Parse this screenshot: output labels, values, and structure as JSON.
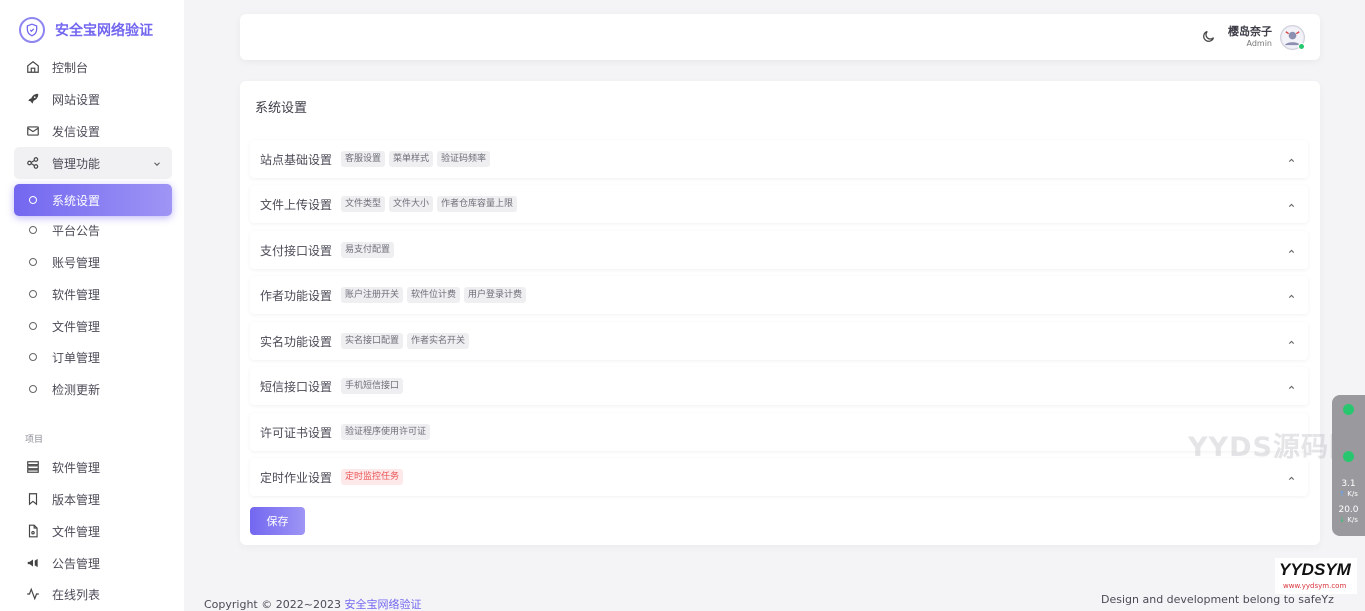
{
  "brand": {
    "title": "安全宝网络验证"
  },
  "sidebar": {
    "items": [
      {
        "label": "控制台",
        "icon": "home-icon"
      },
      {
        "label": "网站设置",
        "icon": "rocket-icon"
      },
      {
        "label": "发信设置",
        "icon": "mail-icon"
      }
    ],
    "group": {
      "label": "管理功能",
      "icon": "share-nodes-icon"
    },
    "sub_items": [
      {
        "label": "系统设置",
        "active": true
      },
      {
        "label": "平台公告"
      },
      {
        "label": "账号管理"
      },
      {
        "label": "软件管理"
      },
      {
        "label": "文件管理"
      },
      {
        "label": "订单管理"
      },
      {
        "label": "检测更新"
      }
    ],
    "section_label": "项目",
    "project_items": [
      {
        "label": "软件管理",
        "icon": "server-icon"
      },
      {
        "label": "版本管理",
        "icon": "bookmark-icon"
      },
      {
        "label": "文件管理",
        "icon": "file-icon"
      },
      {
        "label": "公告管理",
        "icon": "megaphone-icon"
      },
      {
        "label": "在线列表",
        "icon": "activity-icon"
      }
    ]
  },
  "header": {
    "user_name": "樱岛奈子",
    "user_role": "Admin"
  },
  "main": {
    "title": "系统设置",
    "sections": [
      {
        "title": "站点基础设置",
        "tags": [
          "客服设置",
          "菜单样式",
          "验证码频率"
        ]
      },
      {
        "title": "文件上传设置",
        "tags": [
          "文件类型",
          "文件大小",
          "作者仓库容量上限"
        ]
      },
      {
        "title": "支付接口设置",
        "tags": [
          "易支付配置"
        ]
      },
      {
        "title": "作者功能设置",
        "tags": [
          "账户注册开关",
          "软件位计费",
          "用户登录计费"
        ]
      },
      {
        "title": "实名功能设置",
        "tags": [
          "实名接口配置",
          "作者实名开关"
        ]
      },
      {
        "title": "短信接口设置",
        "tags": [
          "手机短信接口"
        ]
      },
      {
        "title": "许可证书设置",
        "tags": [
          "验证程序使用许可证"
        ]
      },
      {
        "title": "定时作业设置",
        "tags": [
          "定时监控任务"
        ]
      }
    ],
    "save_label": "保存"
  },
  "footer": {
    "copyright": "Copyright © 2022~2023",
    "link": "安全宝网络验证",
    "right": "Design and development belong to safeYz"
  },
  "widget": {
    "upload": "3.1",
    "upload_unit": "K/s",
    "download": "20.0",
    "download_unit": "K/s"
  },
  "watermark": {
    "text": "YYDS源码网",
    "badge": "YYDSYM",
    "badge_url": "www.yydsym.com"
  },
  "colors": {
    "accent": "#7367f0",
    "danger": "#ea5455",
    "success": "#28c76f"
  }
}
